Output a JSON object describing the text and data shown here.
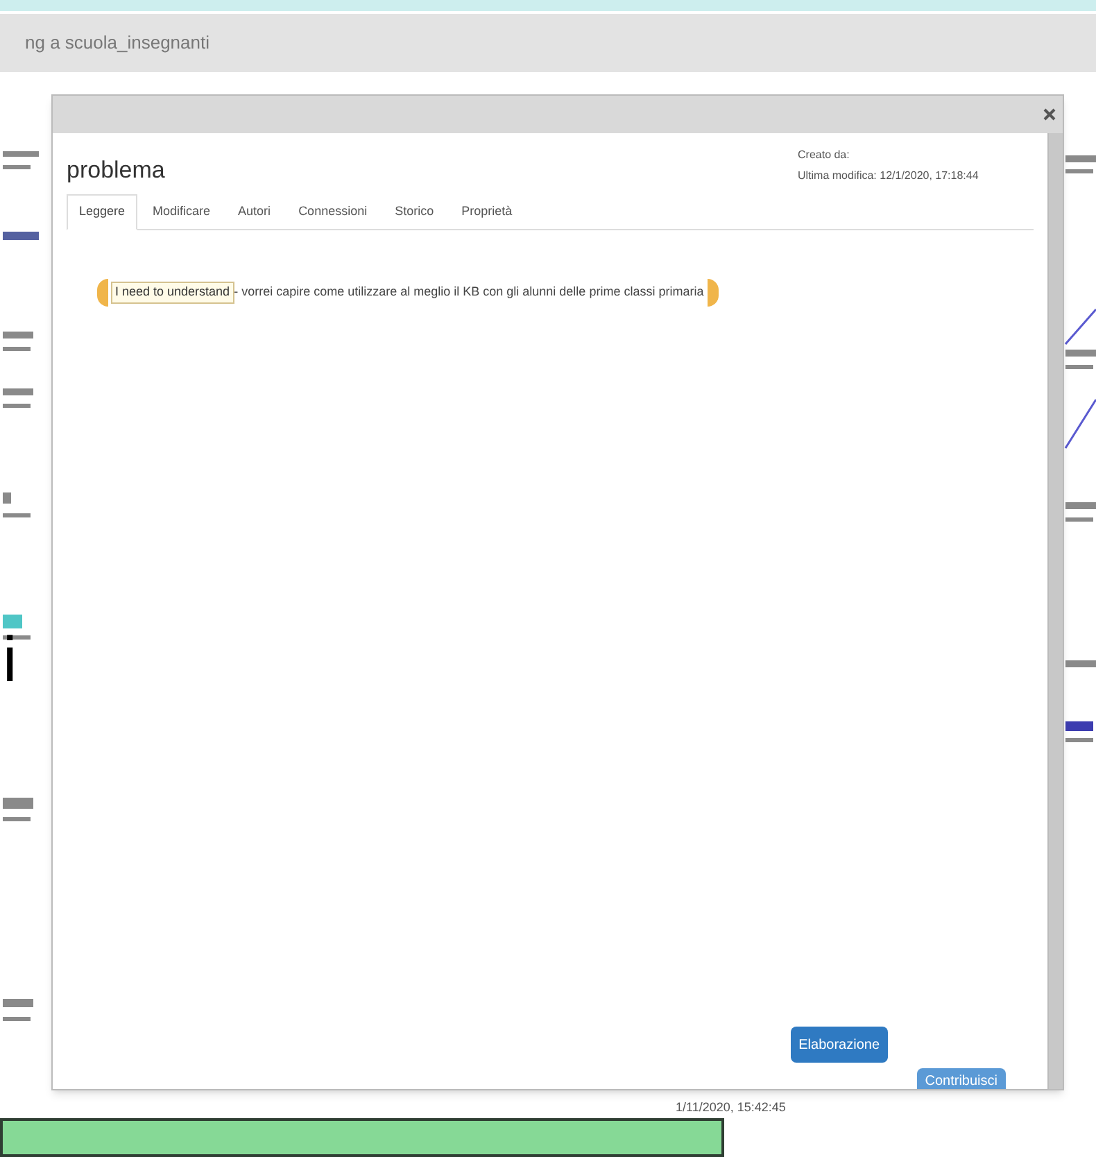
{
  "breadcrumb": "ng a scuola_insegnanti",
  "background": {
    "big_letter": "i",
    "timestamp": "1/11/2020, 15:42:45"
  },
  "dialog": {
    "title": "problema",
    "created_by": "Creato da:",
    "last_modified": "Ultima modifica: 12/1/2020, 17:18:44",
    "tabs": [
      {
        "label": "Leggere",
        "selected": true
      },
      {
        "label": "Modificare",
        "selected": false
      },
      {
        "label": "Autori",
        "selected": false
      },
      {
        "label": "Connessioni",
        "selected": false
      },
      {
        "label": "Storico",
        "selected": false
      },
      {
        "label": "Proprietà",
        "selected": false
      }
    ],
    "scaffold": {
      "label": "I need to understand",
      "text": " - vorrei capire come utilizzare al meglio il KB con gli alunni delle prime classi primaria"
    },
    "buttons": [
      "Elaborazione",
      "Contribuisci"
    ]
  }
}
